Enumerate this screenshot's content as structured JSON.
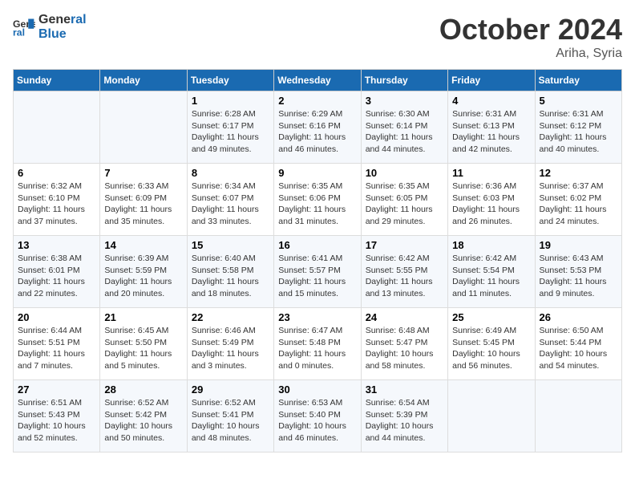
{
  "header": {
    "logo_line1": "General",
    "logo_line2": "Blue",
    "month": "October 2024",
    "location": "Ariha, Syria"
  },
  "days_of_week": [
    "Sunday",
    "Monday",
    "Tuesday",
    "Wednesday",
    "Thursday",
    "Friday",
    "Saturday"
  ],
  "weeks": [
    [
      {
        "day": "",
        "sunrise": "",
        "sunset": "",
        "daylight": ""
      },
      {
        "day": "",
        "sunrise": "",
        "sunset": "",
        "daylight": ""
      },
      {
        "day": "1",
        "sunrise": "Sunrise: 6:28 AM",
        "sunset": "Sunset: 6:17 PM",
        "daylight": "Daylight: 11 hours and 49 minutes."
      },
      {
        "day": "2",
        "sunrise": "Sunrise: 6:29 AM",
        "sunset": "Sunset: 6:16 PM",
        "daylight": "Daylight: 11 hours and 46 minutes."
      },
      {
        "day": "3",
        "sunrise": "Sunrise: 6:30 AM",
        "sunset": "Sunset: 6:14 PM",
        "daylight": "Daylight: 11 hours and 44 minutes."
      },
      {
        "day": "4",
        "sunrise": "Sunrise: 6:31 AM",
        "sunset": "Sunset: 6:13 PM",
        "daylight": "Daylight: 11 hours and 42 minutes."
      },
      {
        "day": "5",
        "sunrise": "Sunrise: 6:31 AM",
        "sunset": "Sunset: 6:12 PM",
        "daylight": "Daylight: 11 hours and 40 minutes."
      }
    ],
    [
      {
        "day": "6",
        "sunrise": "Sunrise: 6:32 AM",
        "sunset": "Sunset: 6:10 PM",
        "daylight": "Daylight: 11 hours and 37 minutes."
      },
      {
        "day": "7",
        "sunrise": "Sunrise: 6:33 AM",
        "sunset": "Sunset: 6:09 PM",
        "daylight": "Daylight: 11 hours and 35 minutes."
      },
      {
        "day": "8",
        "sunrise": "Sunrise: 6:34 AM",
        "sunset": "Sunset: 6:07 PM",
        "daylight": "Daylight: 11 hours and 33 minutes."
      },
      {
        "day": "9",
        "sunrise": "Sunrise: 6:35 AM",
        "sunset": "Sunset: 6:06 PM",
        "daylight": "Daylight: 11 hours and 31 minutes."
      },
      {
        "day": "10",
        "sunrise": "Sunrise: 6:35 AM",
        "sunset": "Sunset: 6:05 PM",
        "daylight": "Daylight: 11 hours and 29 minutes."
      },
      {
        "day": "11",
        "sunrise": "Sunrise: 6:36 AM",
        "sunset": "Sunset: 6:03 PM",
        "daylight": "Daylight: 11 hours and 26 minutes."
      },
      {
        "day": "12",
        "sunrise": "Sunrise: 6:37 AM",
        "sunset": "Sunset: 6:02 PM",
        "daylight": "Daylight: 11 hours and 24 minutes."
      }
    ],
    [
      {
        "day": "13",
        "sunrise": "Sunrise: 6:38 AM",
        "sunset": "Sunset: 6:01 PM",
        "daylight": "Daylight: 11 hours and 22 minutes."
      },
      {
        "day": "14",
        "sunrise": "Sunrise: 6:39 AM",
        "sunset": "Sunset: 5:59 PM",
        "daylight": "Daylight: 11 hours and 20 minutes."
      },
      {
        "day": "15",
        "sunrise": "Sunrise: 6:40 AM",
        "sunset": "Sunset: 5:58 PM",
        "daylight": "Daylight: 11 hours and 18 minutes."
      },
      {
        "day": "16",
        "sunrise": "Sunrise: 6:41 AM",
        "sunset": "Sunset: 5:57 PM",
        "daylight": "Daylight: 11 hours and 15 minutes."
      },
      {
        "day": "17",
        "sunrise": "Sunrise: 6:42 AM",
        "sunset": "Sunset: 5:55 PM",
        "daylight": "Daylight: 11 hours and 13 minutes."
      },
      {
        "day": "18",
        "sunrise": "Sunrise: 6:42 AM",
        "sunset": "Sunset: 5:54 PM",
        "daylight": "Daylight: 11 hours and 11 minutes."
      },
      {
        "day": "19",
        "sunrise": "Sunrise: 6:43 AM",
        "sunset": "Sunset: 5:53 PM",
        "daylight": "Daylight: 11 hours and 9 minutes."
      }
    ],
    [
      {
        "day": "20",
        "sunrise": "Sunrise: 6:44 AM",
        "sunset": "Sunset: 5:51 PM",
        "daylight": "Daylight: 11 hours and 7 minutes."
      },
      {
        "day": "21",
        "sunrise": "Sunrise: 6:45 AM",
        "sunset": "Sunset: 5:50 PM",
        "daylight": "Daylight: 11 hours and 5 minutes."
      },
      {
        "day": "22",
        "sunrise": "Sunrise: 6:46 AM",
        "sunset": "Sunset: 5:49 PM",
        "daylight": "Daylight: 11 hours and 3 minutes."
      },
      {
        "day": "23",
        "sunrise": "Sunrise: 6:47 AM",
        "sunset": "Sunset: 5:48 PM",
        "daylight": "Daylight: 11 hours and 0 minutes."
      },
      {
        "day": "24",
        "sunrise": "Sunrise: 6:48 AM",
        "sunset": "Sunset: 5:47 PM",
        "daylight": "Daylight: 10 hours and 58 minutes."
      },
      {
        "day": "25",
        "sunrise": "Sunrise: 6:49 AM",
        "sunset": "Sunset: 5:45 PM",
        "daylight": "Daylight: 10 hours and 56 minutes."
      },
      {
        "day": "26",
        "sunrise": "Sunrise: 6:50 AM",
        "sunset": "Sunset: 5:44 PM",
        "daylight": "Daylight: 10 hours and 54 minutes."
      }
    ],
    [
      {
        "day": "27",
        "sunrise": "Sunrise: 6:51 AM",
        "sunset": "Sunset: 5:43 PM",
        "daylight": "Daylight: 10 hours and 52 minutes."
      },
      {
        "day": "28",
        "sunrise": "Sunrise: 6:52 AM",
        "sunset": "Sunset: 5:42 PM",
        "daylight": "Daylight: 10 hours and 50 minutes."
      },
      {
        "day": "29",
        "sunrise": "Sunrise: 6:52 AM",
        "sunset": "Sunset: 5:41 PM",
        "daylight": "Daylight: 10 hours and 48 minutes."
      },
      {
        "day": "30",
        "sunrise": "Sunrise: 6:53 AM",
        "sunset": "Sunset: 5:40 PM",
        "daylight": "Daylight: 10 hours and 46 minutes."
      },
      {
        "day": "31",
        "sunrise": "Sunrise: 6:54 AM",
        "sunset": "Sunset: 5:39 PM",
        "daylight": "Daylight: 10 hours and 44 minutes."
      },
      {
        "day": "",
        "sunrise": "",
        "sunset": "",
        "daylight": ""
      },
      {
        "day": "",
        "sunrise": "",
        "sunset": "",
        "daylight": ""
      }
    ]
  ]
}
